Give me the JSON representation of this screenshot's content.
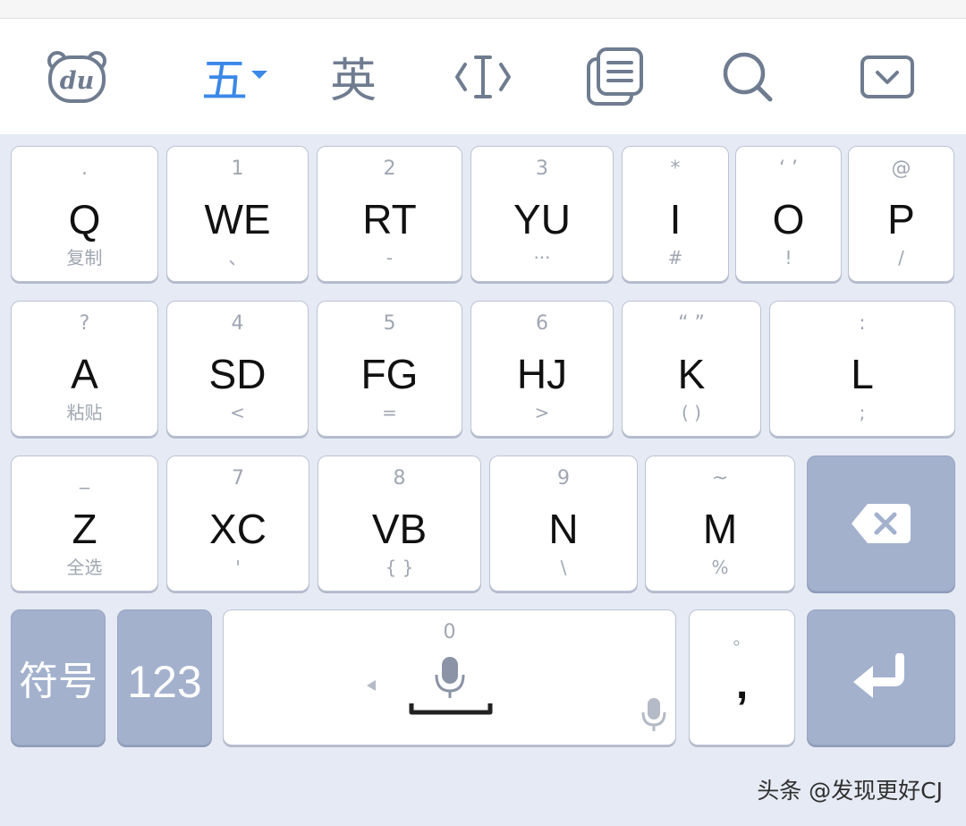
{
  "toolbar": {
    "logo_text": "du",
    "wubi": "五",
    "english": "英",
    "icons": [
      "baidu-logo-icon",
      "cursor-move-icon",
      "clipboard-icon",
      "search-icon",
      "hide-keyboard-icon"
    ]
  },
  "keys": {
    "q": {
      "top": ".",
      "main": "Q",
      "bottom": "复制"
    },
    "we": {
      "top": "1",
      "main": "WE",
      "bottom": "、"
    },
    "rt": {
      "top": "2",
      "main": "RT",
      "bottom": "-"
    },
    "yu": {
      "top": "3",
      "main": "YU",
      "bottom": "···"
    },
    "i": {
      "top": "*",
      "main": "I",
      "bottom": "#"
    },
    "o": {
      "top": "‘ ’",
      "main": "O",
      "bottom": "!"
    },
    "p": {
      "top": "@",
      "main": "P",
      "bottom": "/"
    },
    "a": {
      "top": "?",
      "main": "A",
      "bottom": "粘贴"
    },
    "sd": {
      "top": "4",
      "main": "SD",
      "bottom": "<"
    },
    "fg": {
      "top": "5",
      "main": "FG",
      "bottom": "="
    },
    "hj": {
      "top": "6",
      "main": "HJ",
      "bottom": ">"
    },
    "k": {
      "top": "“ ”",
      "main": "K",
      "bottom": "( )"
    },
    "l": {
      "top": ":",
      "main": "L",
      "bottom": ";"
    },
    "z": {
      "top": "_",
      "main": "Z",
      "bottom": "全选"
    },
    "xc": {
      "top": "7",
      "main": "XC",
      "bottom": "'"
    },
    "vb": {
      "top": "8",
      "main": "VB",
      "bottom": "{ }"
    },
    "n": {
      "top": "9",
      "main": "N",
      "bottom": "\\"
    },
    "m": {
      "top": "~",
      "main": "M",
      "bottom": "%"
    },
    "symbols": "符号",
    "numbers": "123",
    "space_top": "0",
    "comma_top": "。",
    "comma_main": ","
  },
  "colors": {
    "accent": "#3a88e8",
    "keyboard_bg": "#e6eaf4",
    "function_key": "#a3b1cd"
  },
  "watermark": "头条 @发现更好CJ"
}
